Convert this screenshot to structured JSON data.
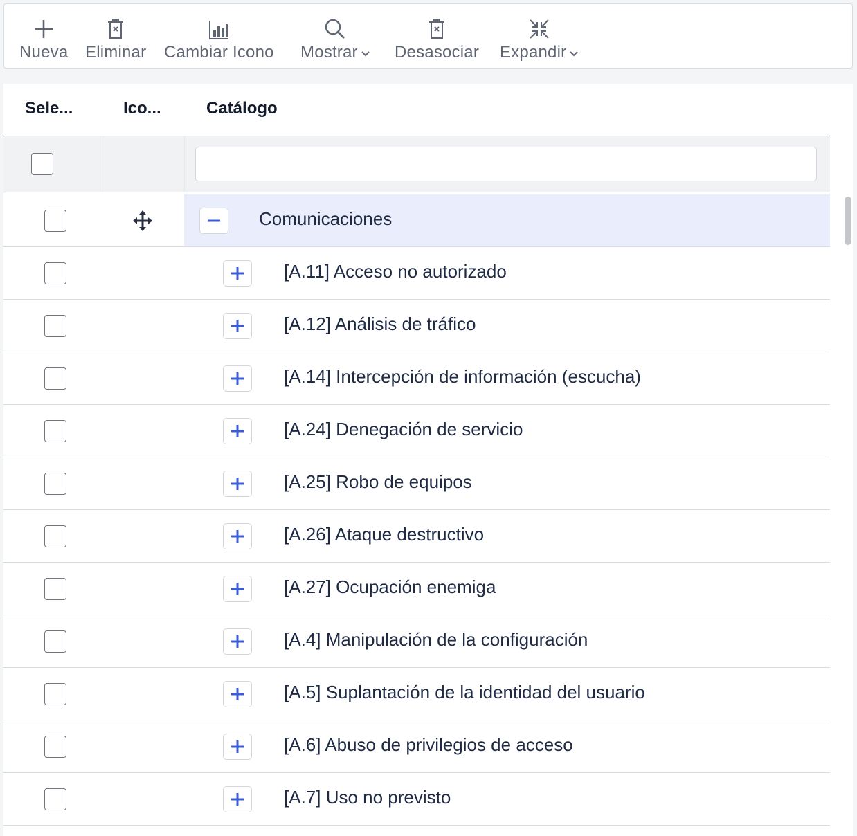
{
  "toolbar": {
    "buttons": [
      {
        "label": "Nueva",
        "icon": "plus-icon"
      },
      {
        "label": "Eliminar",
        "icon": "trash-icon"
      },
      {
        "label": "Cambiar Icono",
        "icon": "bar-chart-icon"
      },
      {
        "label": "Mostrar",
        "icon": "search-icon",
        "dropdown": true
      },
      {
        "label": "Desasociar",
        "icon": "trash-icon"
      },
      {
        "label": "Expandir",
        "icon": "collapse-arrows-icon",
        "dropdown": true
      }
    ]
  },
  "table": {
    "headers": [
      "Sele...",
      "Ico...",
      "Catálogo"
    ],
    "filter_value": "",
    "group": {
      "label": "Comunicaciones",
      "icon": "move-arrows-icon",
      "expanded": true
    },
    "rows": [
      "[A.11] Acceso no autorizado",
      "[A.12] Análisis de tráfico",
      "[A.14] Intercepción de información (escucha)",
      "[A.24] Denegación de servicio",
      "[A.25] Robo de equipos",
      "[A.26] Ataque destructivo",
      "[A.27] Ocupación enemiga",
      "[A.4] Manipulación de la configuración",
      "[A.5] Suplantación de la identidad del usuario",
      "[A.6] Abuso de privilegios de acceso",
      "[A.7] Uso no previsto"
    ]
  },
  "colors": {
    "accent": "#3b5bdb",
    "selected_row": "#eaeefc",
    "toolbar_text": "#5f6573"
  }
}
